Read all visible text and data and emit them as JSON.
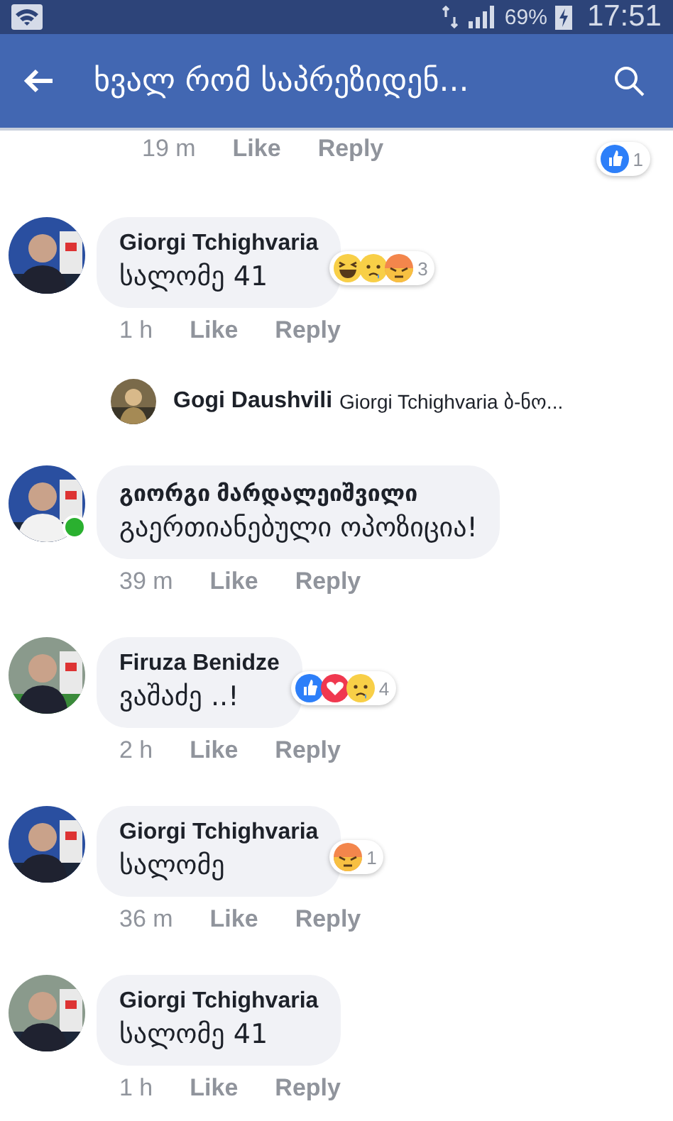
{
  "status_bar": {
    "battery": "69%",
    "time": "17:51"
  },
  "header": {
    "title": "ხვალ რომ საპრეზიდენ..."
  },
  "partial_comment": {
    "time": "19 m",
    "like": "Like",
    "reply": "Reply",
    "reactions": {
      "icons": [
        {
          "kind": "like"
        }
      ],
      "count": "1"
    }
  },
  "items": [
    {
      "kind": "comment",
      "author": "Giorgi Tchighvaria",
      "text": "სალომე 41",
      "online": false,
      "time": "1 h",
      "like": "Like",
      "reply": "Reply",
      "reactions": {
        "icons": [
          {
            "kind": "haha"
          },
          {
            "kind": "sad"
          },
          {
            "kind": "angry"
          }
        ],
        "count": "3"
      }
    },
    {
      "kind": "reply",
      "author": "Gogi Daushvili",
      "text": "Giorgi Tchighvaria ბ-ნო..."
    },
    {
      "kind": "comment",
      "author": "გიორგი მარდალეიშვილი",
      "text": "გაერთიანებული ოპოზიცია!",
      "online": true,
      "time": "39 m",
      "like": "Like",
      "reply": "Reply"
    },
    {
      "kind": "comment",
      "author": "Firuza Benidze",
      "text": "ვაშაძე ..!",
      "online": false,
      "time": "2 h",
      "like": "Like",
      "reply": "Reply",
      "reactions": {
        "icons": [
          {
            "kind": "like"
          },
          {
            "kind": "love"
          },
          {
            "kind": "sad"
          }
        ],
        "count": "4"
      }
    },
    {
      "kind": "comment",
      "author": "Giorgi Tchighvaria",
      "text": "სალომე",
      "online": false,
      "time": "36 m",
      "like": "Like",
      "reply": "Reply",
      "reactions": {
        "icons": [
          {
            "kind": "angry"
          }
        ],
        "count": "1"
      }
    },
    {
      "kind": "comment",
      "author": "Giorgi Tchighvaria",
      "text": "სალომე 41",
      "online": false,
      "time": "1 h",
      "like": "Like",
      "reply": "Reply"
    }
  ]
}
